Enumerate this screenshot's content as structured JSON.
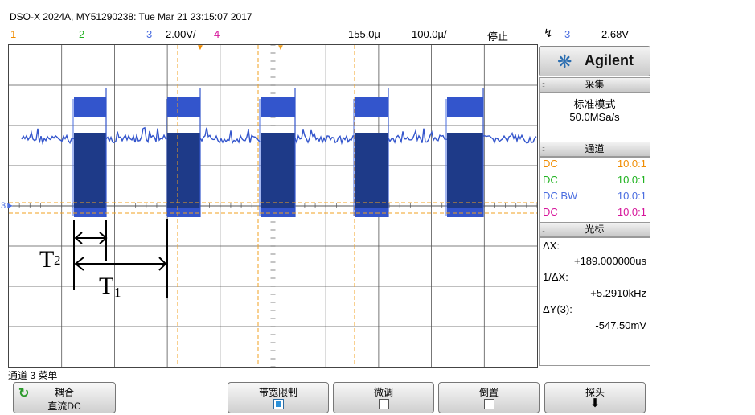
{
  "header": {
    "title": "DSO-X 2024A, MY51290238: Tue Mar 21 23:15:07 2017"
  },
  "status": {
    "ch1": "1",
    "ch2": "2",
    "ch3": "3",
    "ch3_scale": "2.00V/",
    "ch4": "4",
    "delay": "155.0µ",
    "timebase": "100.0µ/",
    "run_state": "停止",
    "trigger_source": "3",
    "trigger_level": "2.68V"
  },
  "logo": {
    "brand": "Agilent"
  },
  "acquire": {
    "header": "采集",
    "mode": "标准模式",
    "rate": "50.0MSa/s"
  },
  "channels": {
    "header": "通道",
    "rows": [
      {
        "coupling": "DC",
        "probe": "10.0:1",
        "color": "#f08c00"
      },
      {
        "coupling": "DC",
        "probe": "10.0:1",
        "color": "#1fb21f"
      },
      {
        "coupling": "DC BW",
        "probe": "10.0:1",
        "color": "#4a6de0"
      },
      {
        "coupling": "DC",
        "probe": "10.0:1",
        "color": "#d6149a"
      }
    ]
  },
  "cursors": {
    "header": "光标",
    "dx_label": "ΔX:",
    "dx_value": "+189.000000us",
    "inv_dx_label": "1/ΔX:",
    "inv_dx_value": "+5.2910kHz",
    "dy_label": "ΔY(3):",
    "dy_value": "-547.50mV"
  },
  "annotations": {
    "t2": "T",
    "t2_sub": "2",
    "t1": "T",
    "t1_sub": "1"
  },
  "menu": {
    "title": "通道 3 菜单",
    "softkeys": [
      {
        "label": "耦合",
        "value": "直流DC"
      },
      {
        "label": "带宽限制"
      },
      {
        "label": "微调"
      },
      {
        "label": "倒置"
      },
      {
        "label": "探头"
      }
    ]
  },
  "colors": {
    "ch1": "#f08c00",
    "ch2": "#1fb21f",
    "ch3": "#3355cc",
    "ch4": "#d6149a",
    "cursor": "#f0a020"
  }
}
